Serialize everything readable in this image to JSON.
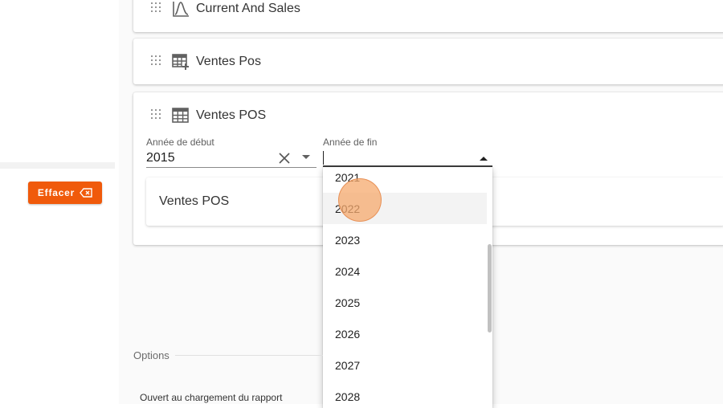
{
  "sidebar": {
    "clear_button_label": "Effacer",
    "clear_icon": "clear-x-icon",
    "accent_color": "#f05a0b"
  },
  "cards": [
    {
      "title": "Current And Sales",
      "icon": "line-chart-icon"
    },
    {
      "title": "Ventes Pos",
      "icon": "table-add-icon"
    },
    {
      "title": "Ventes POS",
      "icon": "table-icon"
    }
  ],
  "filters": {
    "start_year": {
      "label": "Année de début",
      "value": "2015"
    },
    "end_year": {
      "label": "Année de fin",
      "value": ""
    }
  },
  "inner_card": {
    "title": "Ventes POS"
  },
  "dropdown": {
    "options": [
      "2021",
      "2022",
      "2023",
      "2024",
      "2025",
      "2026",
      "2027",
      "2028"
    ],
    "hovered": "2022"
  },
  "options_section": {
    "label": "Options",
    "open_on_load_label": "Ouvert au chargement du rapport"
  }
}
